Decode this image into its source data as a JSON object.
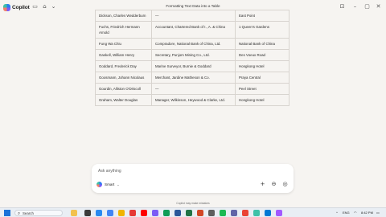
{
  "app": {
    "name": "Copilot",
    "window_title": "Formatting Text Data into a Table"
  },
  "table": {
    "rows": [
      [
        "Dickson, Charles Wedderburn",
        "—",
        "East Point"
      ],
      [
        "Fuchs, Friedrich Hermann Arnold",
        "Accountant, Chartered Bank of I., A. & China",
        "1 Queen's Gardens"
      ],
      [
        "Fung Wa Chiu",
        "Compradore, National Bank of China, Ltd.",
        "National Bank of China"
      ],
      [
        "Gaskell, William Henry",
        "Secretary, Punjom Mining Co., Ltd.",
        "Des Voeux Road"
      ],
      [
        "Goddard, Frederick Day",
        "Marine Surveyor, Burnie & Goddard",
        "Hongkong Hotel"
      ],
      [
        "Goosmann, Johann Nicolaus",
        "Merchant, Jardine Matheson & Co.",
        "Praya Central"
      ],
      [
        "Gourdin, Alliston O'Driscoll",
        "—",
        "Peel Street"
      ],
      [
        "Graham, Walter Douglas",
        "Manager, Wilkinson, Heywood & Clarke, Ltd.",
        "Hongkong Hotel"
      ]
    ]
  },
  "composer": {
    "placeholder": "Ask anything",
    "mode_label": "Smart",
    "disclaimer": "Copilot may make mistakes"
  },
  "taskbar": {
    "search_label": "Search",
    "lang": "ENG",
    "time": "8:42 PM"
  },
  "colors": {
    "background": "#f6f4f1",
    "accent": "#1a73d9"
  }
}
